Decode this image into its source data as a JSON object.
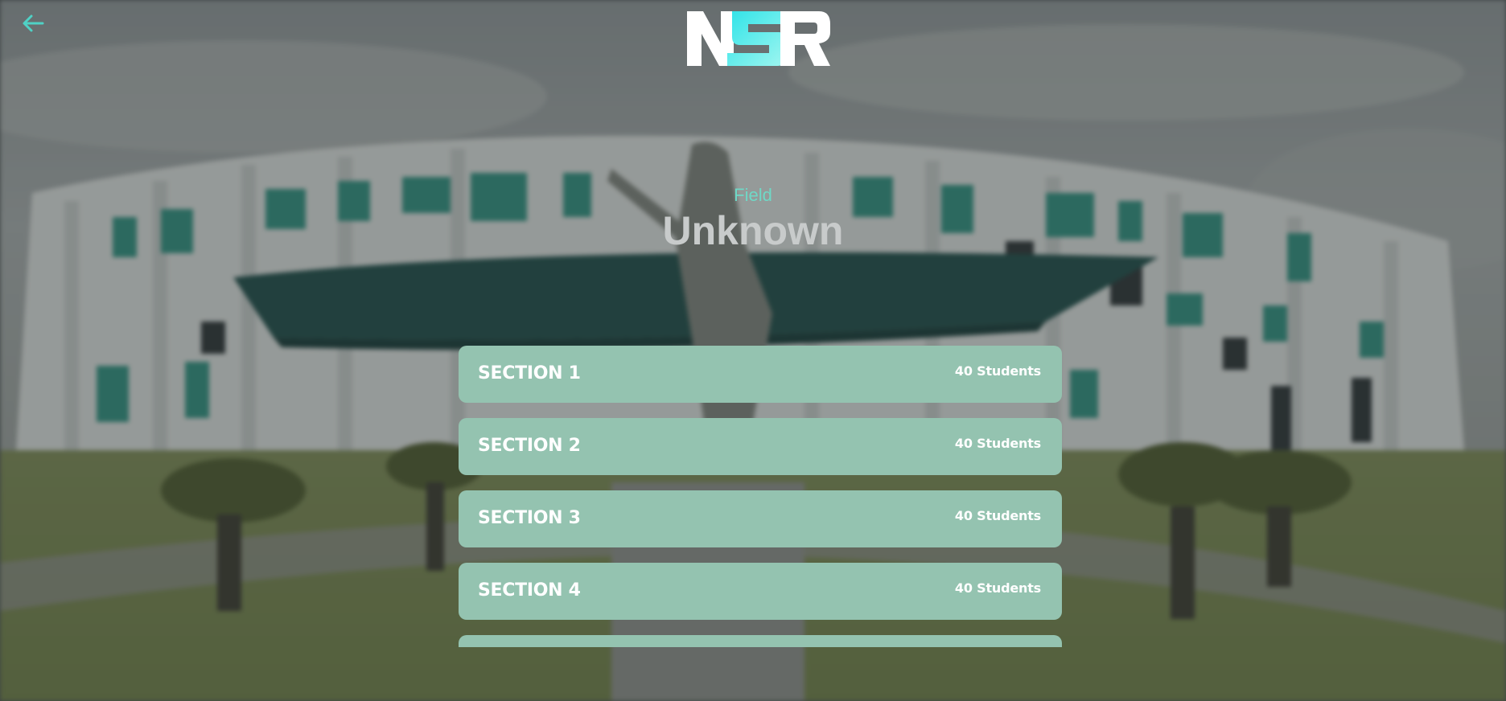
{
  "header": {
    "back_icon": "arrow-left-icon",
    "logo_text": "NSR",
    "accent_color": "#4fd1c5"
  },
  "title": {
    "label": "Field",
    "value": "Unknown"
  },
  "sections": [
    {
      "name": "SECTION 1",
      "count": "40 Students"
    },
    {
      "name": "SECTION 2",
      "count": "40 Students"
    },
    {
      "name": "SECTION 3",
      "count": "40 Students"
    },
    {
      "name": "SECTION 4",
      "count": "40 Students"
    },
    {
      "name": "",
      "count": ""
    }
  ],
  "colors": {
    "card": "#94c3b0",
    "card_text": "#ffffff",
    "field_label": "#6fd8c6",
    "field_value": "#c8cbcb"
  }
}
